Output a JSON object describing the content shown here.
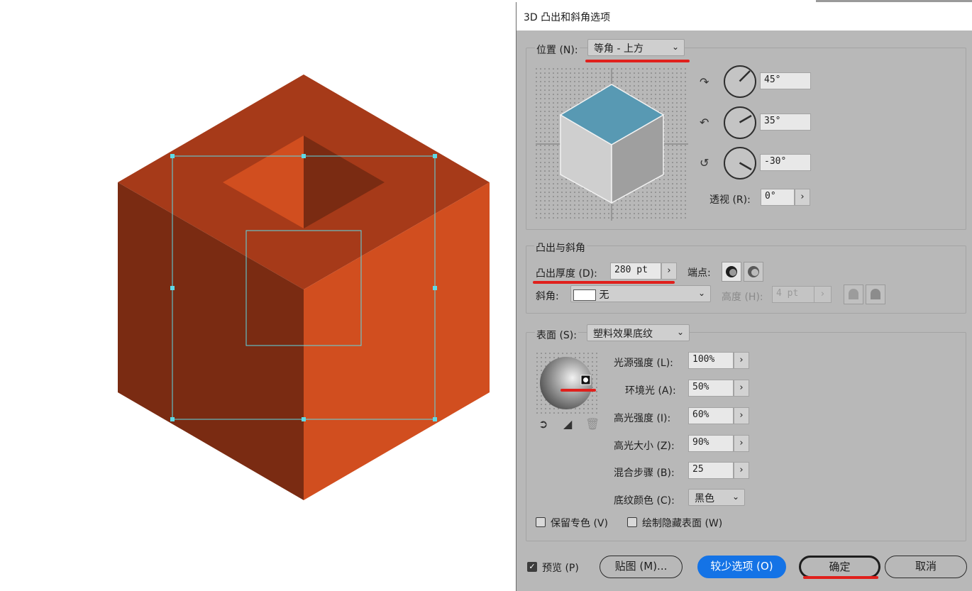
{
  "dialog": {
    "title": "3D 凸出和斜角选项",
    "position": {
      "label": "位置 (N):",
      "value": "等角 - 上方",
      "rotate_x": "45°",
      "rotate_y": "35°",
      "rotate_z": "-30°",
      "perspective_label": "透视 (R):",
      "perspective_value": "0°"
    },
    "extrude": {
      "section_title": "凸出与斜角",
      "depth_label": "凸出厚度 (D):",
      "depth_value": "280 pt",
      "cap_label": "端点:",
      "bevel_label": "斜角:",
      "bevel_value": "无",
      "height_label": "高度 (H):",
      "height_value": "4 pt"
    },
    "surface": {
      "label": "表面 (S):",
      "value": "塑料效果底纹",
      "light_intensity_label": "光源强度 (L):",
      "light_intensity_value": "100%",
      "ambient_label": "环境光 (A):",
      "ambient_value": "50%",
      "highlight_intensity_label": "高光强度 (I):",
      "highlight_intensity_value": "60%",
      "highlight_size_label": "高光大小 (Z):",
      "highlight_size_value": "90%",
      "blend_steps_label": "混合步骤 (B):",
      "blend_steps_value": "25",
      "shade_color_label": "底纹颜色 (C):",
      "shade_color_value": "黑色",
      "preserve_spot_label": "保留专色 (V)",
      "draw_hidden_label": "绘制隐藏表面 (W)"
    },
    "footer": {
      "preview_label": "预览 (P)",
      "map_art_label": "贴图 (M)...",
      "fewer_options_label": "较少选项 (O)",
      "ok_label": "确定",
      "cancel_label": "取消"
    }
  },
  "colors": {
    "cube_top": "#a63a19",
    "cube_left": "#7a2b12",
    "cube_right": "#d14e1f",
    "selection": "#5fd9e6",
    "preview_top": "#5899b3",
    "accent": "#1473e6",
    "annotation": "#e0201c"
  }
}
